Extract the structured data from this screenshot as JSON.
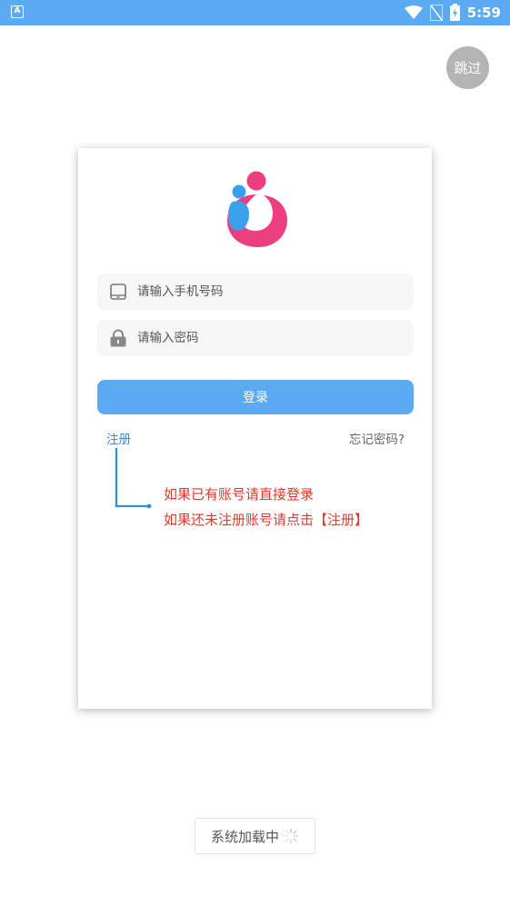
{
  "status_bar": {
    "time": "5:59",
    "left_icon_letter": "A",
    "icons": [
      "wifi-icon",
      "no-sim-icon",
      "battery-charging-icon"
    ]
  },
  "skip_label": "跳过",
  "login_form": {
    "phone_placeholder": "请输入手机号码",
    "password_placeholder": "请输入密码",
    "login_label": "登录",
    "register_label": "注册",
    "forgot_label": "忘记密码?"
  },
  "hint": {
    "line1": "如果已有账号请直接登录",
    "line2": "如果还未注册账号请点击【注册】"
  },
  "loading_text": "系统加载中",
  "colors": {
    "accent": "#5aabf3",
    "logo_pink": "#ec3f82",
    "logo_blue": "#3aa0ee",
    "hint_red": "#e03a2e",
    "link_blue": "#3b8ed0"
  }
}
